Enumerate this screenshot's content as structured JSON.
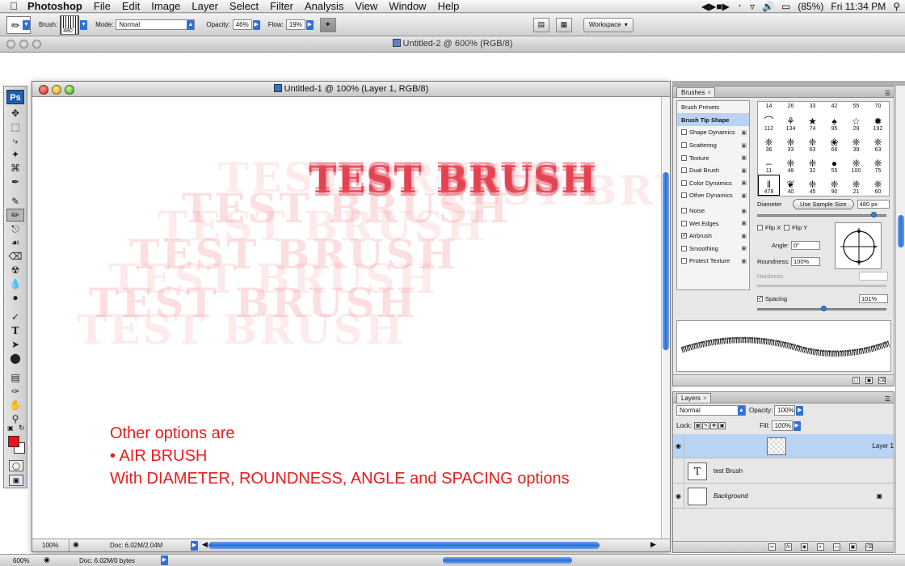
{
  "menubar": {
    "app": "Photoshop",
    "items": [
      "File",
      "Edit",
      "Image",
      "Layer",
      "Select",
      "Filter",
      "Analysis",
      "View",
      "Window",
      "Help"
    ],
    "battery": "(85%)",
    "clock": "Fri 11:34 PM"
  },
  "options": {
    "brush_label": "Brush:",
    "brush_size": "480",
    "mode_label": "Mode:",
    "mode_value": "Normal",
    "opacity_label": "Opacity:",
    "opacity_value": "46%",
    "flow_label": "Flow:",
    "flow_value": "19%",
    "workspace_label": "Workspace"
  },
  "back_window": {
    "title": "Untitled-2 @ 600% (RGB/8)",
    "zoom": "600%",
    "doc_info": "Doc: 6.02M/0 bytes"
  },
  "document": {
    "title": "Untitled-1 @ 100% (Layer 1, RGB/8)",
    "zoom": "100%",
    "doc_info": "Doc: 6.02M/2.04M",
    "stroke_text": "TEST BRUSH",
    "note_lines": [
      "Other options are",
      "• AIR BRUSH",
      "With DIAMETER, ROUNDNESS, ANGLE and SPACING options"
    ]
  },
  "brushes_panel": {
    "tab": "Brushes",
    "presets_label": "Brush Presets",
    "tip_shape_label": "Brush Tip Shape",
    "options": [
      {
        "label": "Shape Dynamics",
        "checked": false
      },
      {
        "label": "Scattering",
        "checked": false
      },
      {
        "label": "Texture",
        "checked": false
      },
      {
        "label": "Dual Brush",
        "checked": false
      },
      {
        "label": "Color Dynamics",
        "checked": false
      },
      {
        "label": "Other Dynamics",
        "checked": false
      },
      {
        "label": "Noise",
        "checked": false
      },
      {
        "label": "Wet Edges",
        "checked": false
      },
      {
        "label": "Airbrush",
        "checked": true
      },
      {
        "label": "Smoothing",
        "checked": false
      },
      {
        "label": "Protect Texture",
        "checked": false
      }
    ],
    "tip_header": [
      "14",
      "26",
      "33",
      "42",
      "55",
      "70"
    ],
    "tip_rows": [
      [
        "112",
        "134",
        "74",
        "95",
        "29",
        "192"
      ],
      [
        "36",
        "33",
        "63",
        "66",
        "39",
        "63"
      ],
      [
        "11",
        "48",
        "32",
        "55",
        "100",
        "75"
      ],
      [
        "478",
        "40",
        "45",
        "90",
        "21",
        "60"
      ]
    ],
    "diameter_label": "Diameter",
    "use_sample_label": "Use Sample Size",
    "diameter_value": "480 px",
    "flip_x": "Flip X",
    "flip_y": "Flip Y",
    "angle_label": "Angle:",
    "angle_value": "0°",
    "roundness_label": "Roundness:",
    "roundness_value": "100%",
    "hardness_label": "Hardness",
    "spacing_label": "Spacing",
    "spacing_value": "101%"
  },
  "layers_panel": {
    "tab": "Layers",
    "blend_mode": "Normal",
    "opacity_label": "Opacity:",
    "opacity_value": "100%",
    "lock_label": "Lock:",
    "fill_label": "Fill:",
    "fill_value": "100%",
    "layers": [
      {
        "name": "Layer 1",
        "visible": true,
        "selected": true
      },
      {
        "name": "test Brush",
        "visible": false,
        "selected": false
      },
      {
        "name": "Background",
        "visible": true,
        "selected": false
      }
    ]
  },
  "colors": {
    "foreground": "#e8131a",
    "background": "#ffffff",
    "accent": "#2e6fd8"
  }
}
